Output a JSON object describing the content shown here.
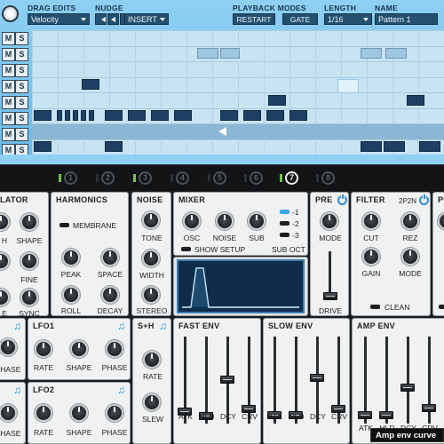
{
  "toolbar": {
    "drag_edits": {
      "label": "DRAG EDITS",
      "value": "Velocity"
    },
    "nudge": {
      "label": "NUDGE"
    },
    "insert": {
      "value": "INSERT"
    },
    "playback_modes": {
      "label": "PLAYBACK MODES",
      "restart": "RESTART",
      "gate": "GATE"
    },
    "length": {
      "label": "LENGTH",
      "value": "1/16"
    },
    "name": {
      "label": "NAME",
      "value": "Pattern 1"
    }
  },
  "rows": {
    "mute": "M",
    "solo": "S"
  },
  "pages": [
    {
      "label": "1",
      "led": true,
      "active": false
    },
    {
      "label": "2",
      "led": false,
      "active": false
    },
    {
      "label": "3",
      "led": true,
      "active": false
    },
    {
      "label": "4",
      "led": false,
      "active": false
    },
    {
      "label": "5",
      "led": false,
      "active": false
    },
    {
      "label": "6",
      "led": false,
      "active": false
    },
    {
      "label": "7",
      "led": true,
      "active": true
    },
    {
      "label": "8",
      "led": false,
      "active": false
    }
  ],
  "oscillator": {
    "title": "LATOR",
    "shape": "SHAPE",
    "fine": "FINE",
    "sync": "SYNC",
    "partial1": "H",
    "partial2": "E"
  },
  "harmonics": {
    "title": "HARMONICS",
    "membrane": "MEMBRANE",
    "peak": "PEAK",
    "space": "SPACE",
    "roll": "ROLL",
    "decay": "DECAY"
  },
  "noise": {
    "title": "NOISE",
    "tone": "TONE",
    "width": "WIDTH",
    "stereo": "STEREO"
  },
  "mixer": {
    "title": "MIXER",
    "osc": "OSC",
    "noise": "NOISE",
    "sub": "SUB",
    "sub1": "-1",
    "sub2": "-2",
    "sub3": "-3",
    "show_setup": "SHOW SETUP",
    "sub_oct": "SUB OCT"
  },
  "pre": {
    "title": "PRE",
    "mode": "MODE",
    "drive": "DRIVE"
  },
  "filter": {
    "title": "FILTER",
    "type": "2P2N",
    "cut": "CUT",
    "rez": "REZ",
    "gain": "GAIN",
    "mode": "MODE",
    "clean": "CLEAN"
  },
  "post": {
    "title": "PO"
  },
  "lfo0": {
    "phase": "PHASE"
  },
  "lfo1": {
    "title": "LFO1",
    "rate": "RATE",
    "shape": "SHAPE",
    "phase": "PHASE"
  },
  "lfo2": {
    "title": "LFO2",
    "rate": "RATE",
    "shape": "SHAPE",
    "phase": "PHASE"
  },
  "lfo3": {
    "phase": "PHASE"
  },
  "sh": {
    "title": "S+H",
    "rate": "RATE",
    "slew": "SLEW"
  },
  "fast_env": {
    "title": "FAST ENV",
    "atk": "ATK",
    "hld": "HLD",
    "dcy": "DCY",
    "crv": "CRV"
  },
  "slow_env": {
    "title": "SLOW ENV",
    "atk": "ATK",
    "hld": "HLD",
    "dcy": "DCY",
    "crv": "CRV"
  },
  "amp_env": {
    "title": "AMP ENV",
    "atk": "ATK",
    "hld": "HLD",
    "dcy": "DCY",
    "crv": "CRV"
  },
  "tooltip": "Amp env curve",
  "colors": {
    "seq_bg": "#8fd0f4",
    "step_on": "#1d3f63",
    "accent": "#2a8fd4",
    "led_green": "#74c44d"
  }
}
